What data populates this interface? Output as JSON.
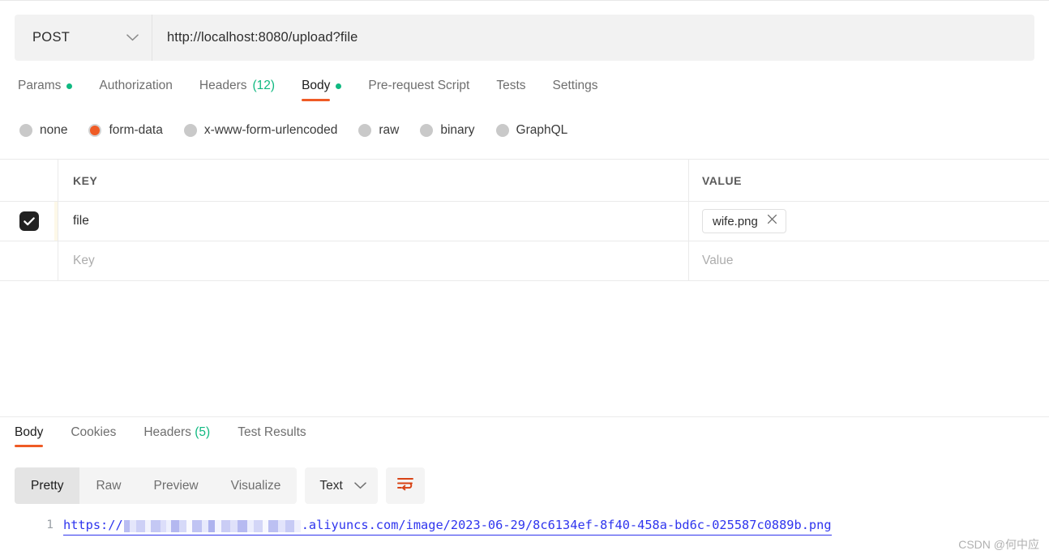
{
  "request": {
    "method": "POST",
    "url": "http://localhost:8080/upload?file",
    "tabs": [
      {
        "label": "Params",
        "dot": true
      },
      {
        "label": "Authorization",
        "dot": false
      },
      {
        "label": "Headers",
        "count": "(12)"
      },
      {
        "label": "Body",
        "dot": true,
        "active": true
      },
      {
        "label": "Pre-request Script"
      },
      {
        "label": "Tests"
      },
      {
        "label": "Settings"
      }
    ],
    "body_types": [
      {
        "label": "none",
        "selected": false
      },
      {
        "label": "form-data",
        "selected": true
      },
      {
        "label": "x-www-form-urlencoded",
        "selected": false
      },
      {
        "label": "raw",
        "selected": false
      },
      {
        "label": "binary",
        "selected": false
      },
      {
        "label": "GraphQL",
        "selected": false
      }
    ],
    "table": {
      "headers": {
        "key": "KEY",
        "value": "VALUE"
      },
      "rows": [
        {
          "checked": true,
          "key": "file",
          "value": "wife.png",
          "type": "file"
        }
      ],
      "empty_row": {
        "key_placeholder": "Key",
        "value_placeholder": "Value"
      }
    }
  },
  "response": {
    "tabs": [
      {
        "label": "Body",
        "active": true
      },
      {
        "label": "Cookies"
      },
      {
        "label": "Headers",
        "count": "(5)"
      },
      {
        "label": "Test Results"
      }
    ],
    "format_segments": [
      {
        "label": "Pretty",
        "active": true
      },
      {
        "label": "Raw"
      },
      {
        "label": "Preview"
      },
      {
        "label": "Visualize"
      }
    ],
    "content_type": "Text",
    "line_number": "1",
    "url_prefix": "https://",
    "url_suffix": ".aliyuncs.com/image/2023-06-29/8c6134ef-8f40-458a-bd6c-025587c0889b.png"
  },
  "watermark": "CSDN @何中应",
  "colors": {
    "accent": "#ef5b25",
    "green": "#10b981",
    "link": "#2f35ee",
    "checkbox": "#212121"
  }
}
